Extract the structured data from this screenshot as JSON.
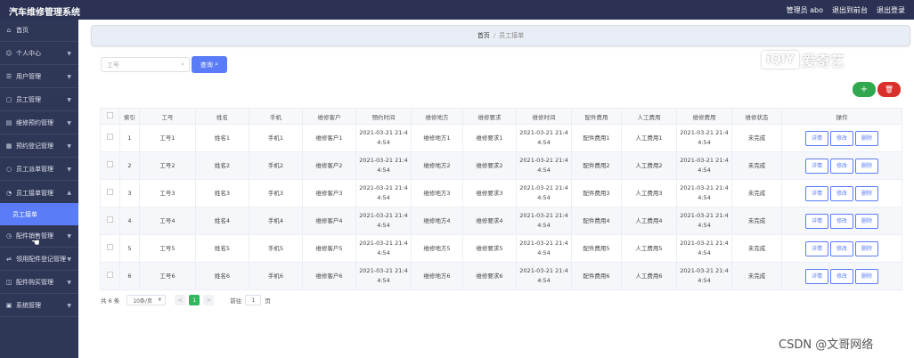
{
  "header": {
    "app_title": "汽车维修管理系统",
    "user_label": "管理员 abo",
    "back_front": "退出到前台",
    "logout": "退出登录"
  },
  "sidebar": {
    "items": [
      {
        "label": "首页",
        "icon": "home-icon"
      },
      {
        "label": "个人中心",
        "icon": "user-icon"
      },
      {
        "label": "用户管理",
        "icon": "users-icon"
      },
      {
        "label": "员工管理",
        "icon": "staff-icon"
      },
      {
        "label": "维修预约管理",
        "icon": "calendar-icon"
      },
      {
        "label": "预约登记管理",
        "icon": "register-icon"
      },
      {
        "label": "员工派单管理",
        "icon": "dispatch-icon"
      },
      {
        "label": "员工接单管理",
        "icon": "accept-icon"
      },
      {
        "label": "配件销售管理",
        "icon": "sales-icon"
      },
      {
        "label": "领用配件登记管理",
        "icon": "parts-icon"
      },
      {
        "label": "配件购买管理",
        "icon": "cart-icon"
      },
      {
        "label": "系统管理",
        "icon": "system-icon"
      }
    ],
    "active_sub": "员工接单"
  },
  "breadcrumb": {
    "home": "首页",
    "separator": "/",
    "current": "员工接单"
  },
  "search": {
    "placeholder": "工号",
    "button": "查询"
  },
  "actions": {
    "add": "+",
    "delete": "🗑"
  },
  "table": {
    "headers": [
      "",
      "索引",
      "工号",
      "姓名",
      "手机",
      "维修客户",
      "预约时间",
      "维修地方",
      "维修要求",
      "维修时间",
      "配件费用",
      "人工费用",
      "维修费用",
      "维修状态",
      "操作"
    ],
    "rows": [
      {
        "idx": "1",
        "no": "工号1",
        "name": "姓名1",
        "phone": "手机1",
        "customer": "维修客户1",
        "appt_a": "2021-03-21 21:4",
        "appt_b": "4:54",
        "place": "维修地方1",
        "req": "维修要求1",
        "fix_a": "2021-03-21 21:4",
        "fix_b": "4:54",
        "parts": "配件费用1",
        "labor": "人工费用1",
        "cost_a": "2021-03-21 21:4",
        "cost_b": "4:54",
        "status": "未完成"
      },
      {
        "idx": "2",
        "no": "工号2",
        "name": "姓名2",
        "phone": "手机2",
        "customer": "维修客户2",
        "appt_a": "2021-03-21 21:4",
        "appt_b": "4:54",
        "place": "维修地方2",
        "req": "维修要求2",
        "fix_a": "2021-03-21 21:4",
        "fix_b": "4:54",
        "parts": "配件费用2",
        "labor": "人工费用2",
        "cost_a": "2021-03-21 21:4",
        "cost_b": "4:54",
        "status": "未完成"
      },
      {
        "idx": "3",
        "no": "工号3",
        "name": "姓名3",
        "phone": "手机3",
        "customer": "维修客户3",
        "appt_a": "2021-03-21 21:4",
        "appt_b": "4:54",
        "place": "维修地方3",
        "req": "维修要求3",
        "fix_a": "2021-03-21 21:4",
        "fix_b": "4:54",
        "parts": "配件费用3",
        "labor": "人工费用3",
        "cost_a": "2021-03-21 21:4",
        "cost_b": "4:54",
        "status": "未完成"
      },
      {
        "idx": "4",
        "no": "工号4",
        "name": "姓名4",
        "phone": "手机4",
        "customer": "维修客户4",
        "appt_a": "2021-03-21 21:4",
        "appt_b": "4:54",
        "place": "维修地方4",
        "req": "维修要求4",
        "fix_a": "2021-03-21 21:4",
        "fix_b": "4:54",
        "parts": "配件费用4",
        "labor": "人工费用4",
        "cost_a": "2021-03-21 21:4",
        "cost_b": "4:54",
        "status": "未完成"
      },
      {
        "idx": "5",
        "no": "工号5",
        "name": "姓名5",
        "phone": "手机5",
        "customer": "维修客户5",
        "appt_a": "2021-03-21 21:4",
        "appt_b": "4:54",
        "place": "维修地方5",
        "req": "维修要求5",
        "fix_a": "2021-03-21 21:4",
        "fix_b": "4:54",
        "parts": "配件费用5",
        "labor": "人工费用5",
        "cost_a": "2021-03-21 21:4",
        "cost_b": "4:54",
        "status": "未完成"
      },
      {
        "idx": "6",
        "no": "工号6",
        "name": "姓名6",
        "phone": "手机6",
        "customer": "维修客户6",
        "appt_a": "2021-03-21 21:4",
        "appt_b": "4:54",
        "place": "维修地方6",
        "req": "维修要求6",
        "fix_a": "2021-03-21 21:4",
        "fix_b": "4:54",
        "parts": "配件费用6",
        "labor": "人工费用6",
        "cost_a": "2021-03-21 21:4",
        "cost_b": "4:54",
        "status": "未完成"
      }
    ],
    "ops": {
      "detail": "详情",
      "edit": "修改",
      "delete": "删除"
    }
  },
  "pager": {
    "total": "共 6 条",
    "page_size": "10条/页",
    "prev": "<",
    "current": "1",
    "next": ">",
    "goto_label": "前往",
    "goto_value": "1",
    "page_suffix": "页"
  },
  "watermarks": {
    "iqiyi_box": "iQIY",
    "iqiyi_text": "爱奇艺",
    "csdn": "CSDN @文哥网络"
  },
  "colors": {
    "topbar": "#2b3253",
    "sidebar": "#2f3756",
    "accent": "#5a7cf8",
    "add": "#2fa84f",
    "delete": "#d9302c"
  }
}
